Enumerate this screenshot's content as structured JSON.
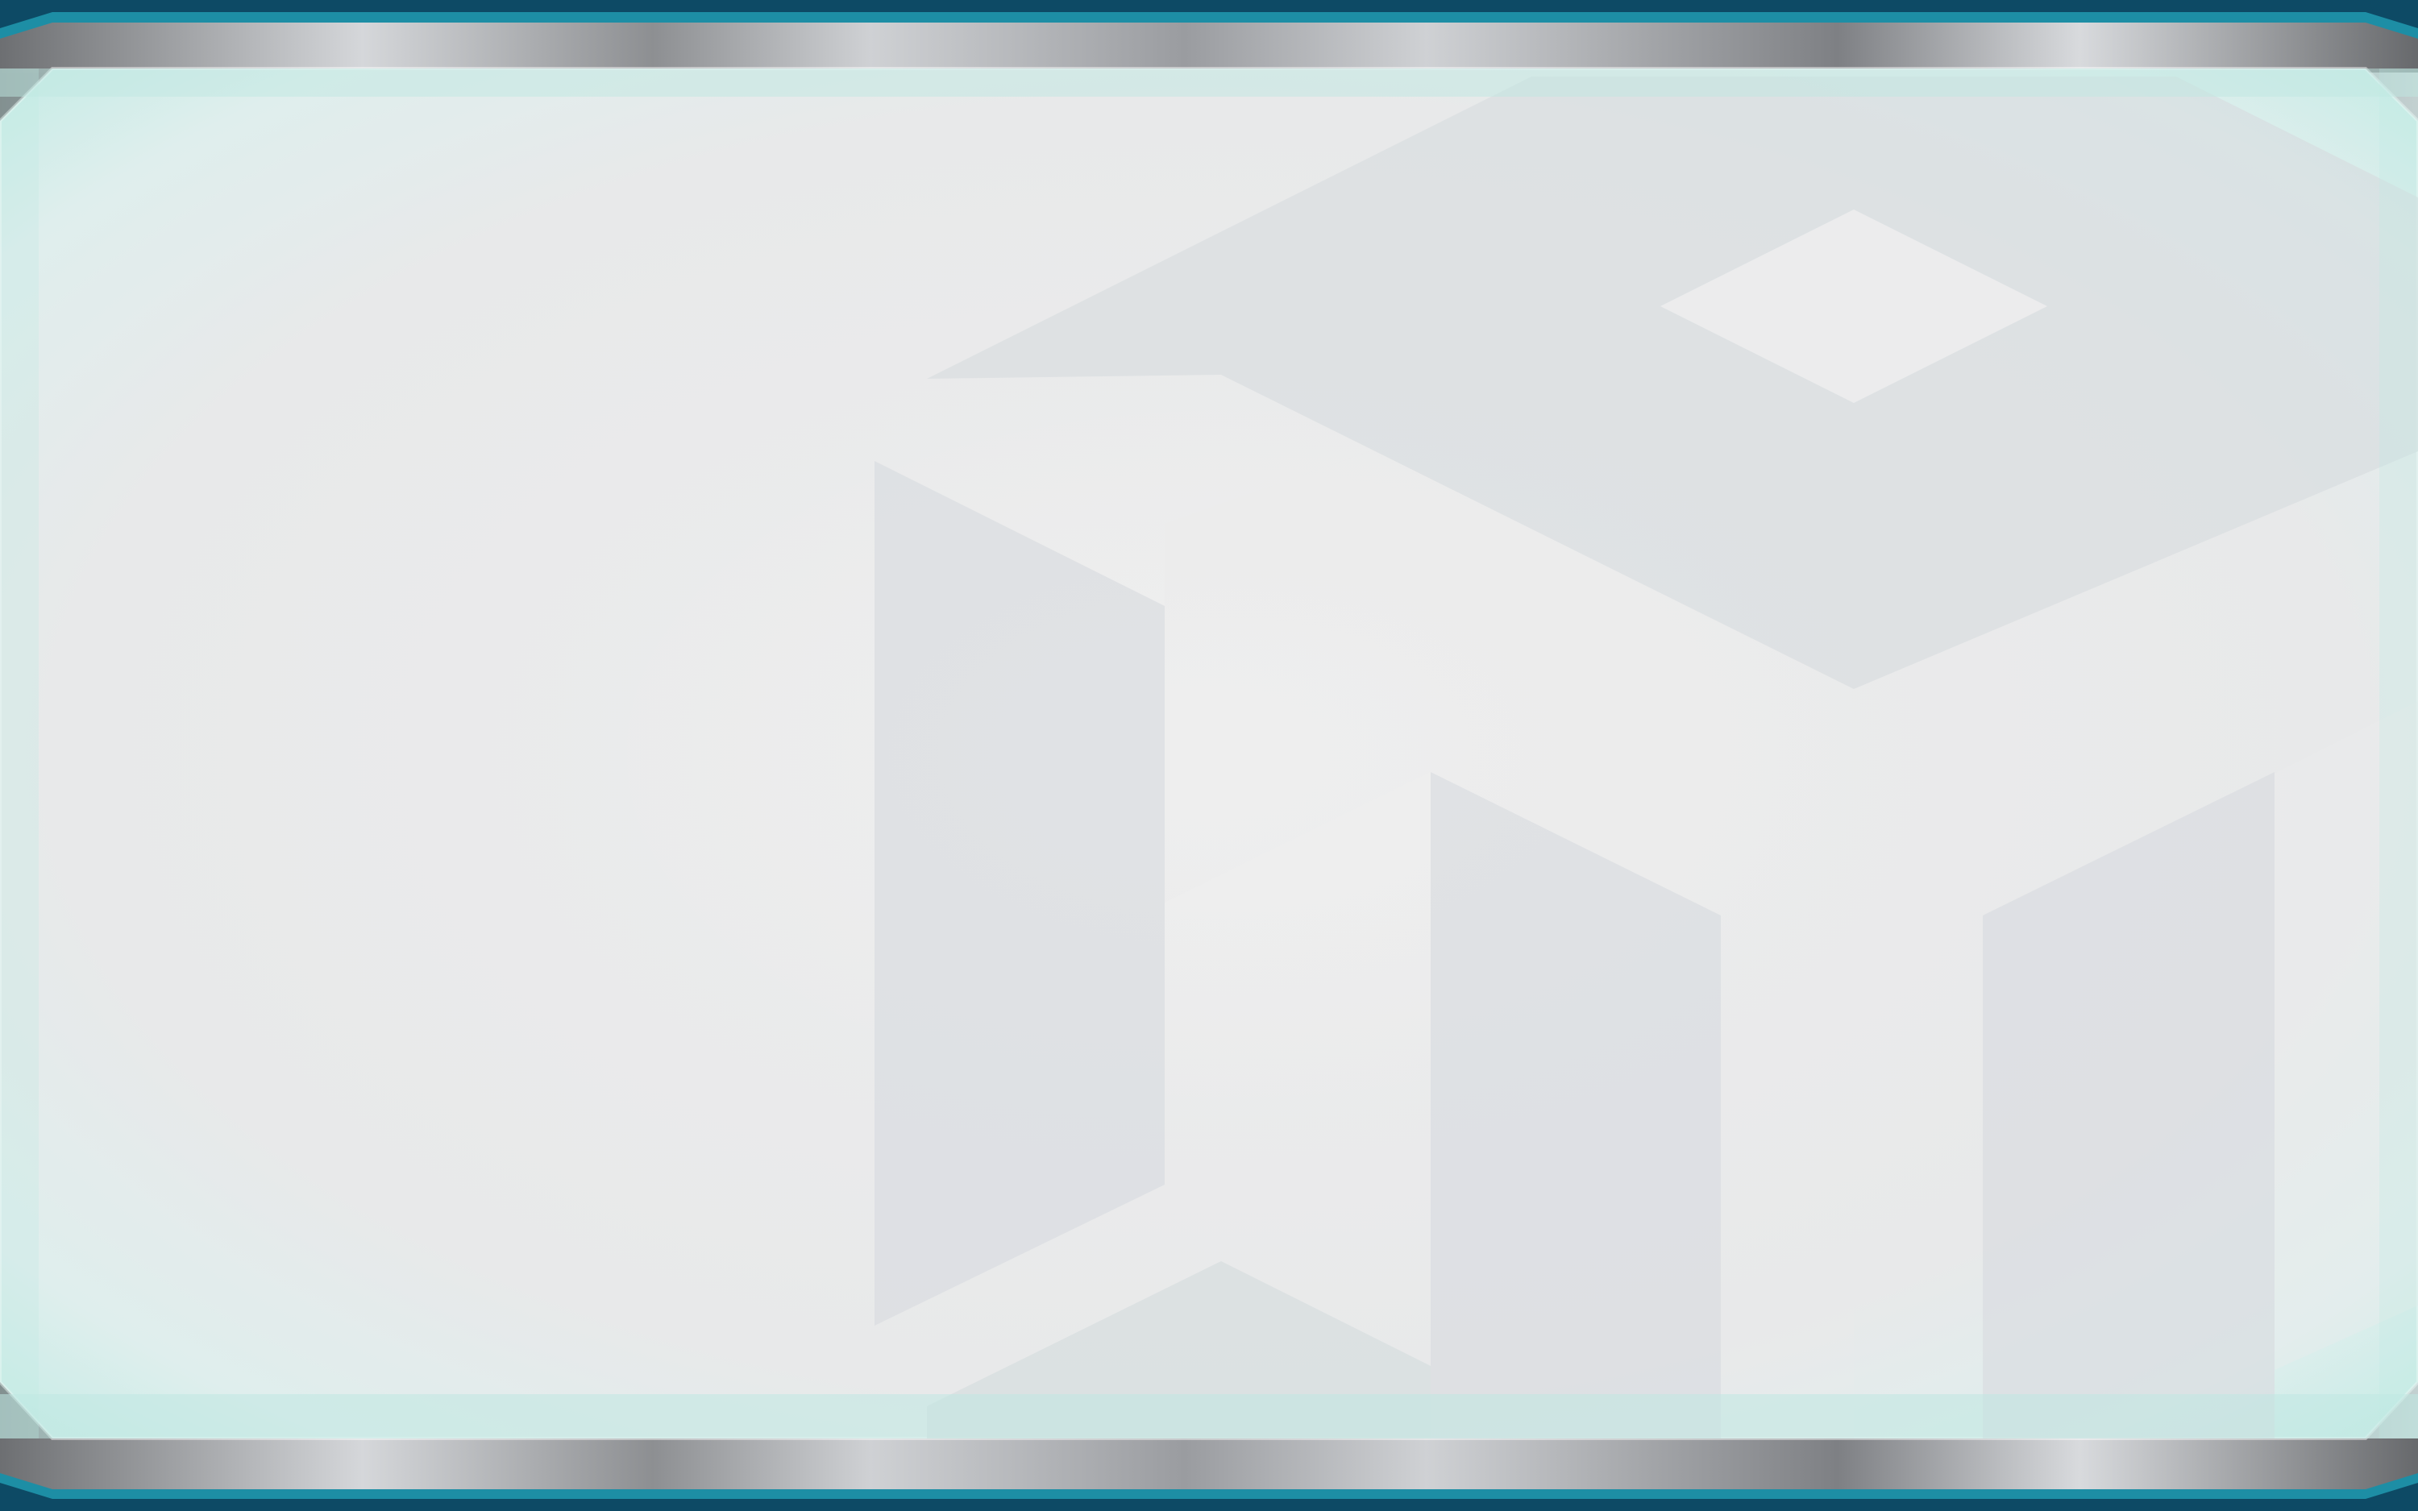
{
  "screen": {
    "title": "",
    "visible_text": []
  },
  "colors": {
    "frame_outer": "#0d4a65",
    "frame_teal": "#1d8ea5",
    "frame_metal_light": "#d3d5d8",
    "frame_metal_dark": "#6f7174",
    "panel_base": "#e8e9ea",
    "panel_glow": "#bfe8e2",
    "panel_shape": "#d8dcdf",
    "panel_highlight": "#eeeeee"
  },
  "icons": {
    "watermark": "geometric-block-watermark-icon"
  }
}
